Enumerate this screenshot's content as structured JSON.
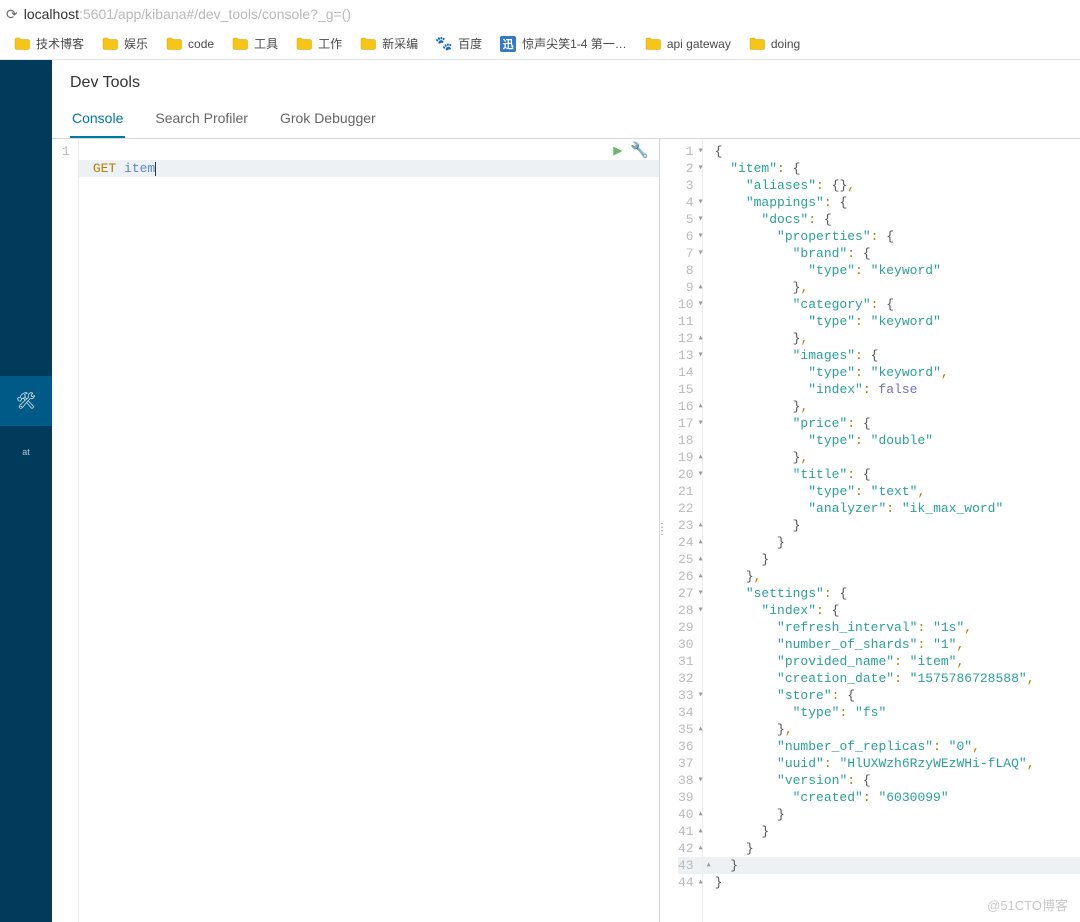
{
  "url": {
    "prefix_symbol": "⟳",
    "host": "localhost",
    "rest": ":5601/app/kibana#/dev_tools/console?_g=()"
  },
  "bookmarks": [
    {
      "label": "技术博客",
      "type": "folder"
    },
    {
      "label": "娱乐",
      "type": "folder"
    },
    {
      "label": "code",
      "type": "folder"
    },
    {
      "label": "工具",
      "type": "folder"
    },
    {
      "label": "工作",
      "type": "folder"
    },
    {
      "label": "新采编",
      "type": "folder"
    },
    {
      "label": "百度",
      "type": "site-baidu"
    },
    {
      "label": "惊声尖笑1-4 第一…",
      "type": "site-bili"
    },
    {
      "label": "api gateway",
      "type": "folder"
    },
    {
      "label": "doing",
      "type": "folder"
    }
  ],
  "sidebar": {
    "active_index": 5,
    "items": [
      "",
      "",
      "",
      "",
      "",
      "",
      "at"
    ]
  },
  "page": {
    "title": "Dev Tools"
  },
  "tabs": [
    {
      "label": "Console",
      "active": true
    },
    {
      "label": "Search Profiler",
      "active": false
    },
    {
      "label": "Grok Debugger",
      "active": false
    }
  ],
  "request": {
    "line_no": "1",
    "method": "GET",
    "endpoint": "item"
  },
  "response_lines": [
    {
      "n": 1,
      "fold": "down",
      "txt": [
        [
          "brace",
          "{"
        ]
      ]
    },
    {
      "n": 2,
      "fold": "down",
      "txt": [
        [
          "pad",
          1
        ],
        [
          "key",
          "\"item\""
        ],
        [
          "punc",
          ": "
        ],
        [
          "brace",
          "{"
        ]
      ]
    },
    {
      "n": 3,
      "txt": [
        [
          "pad",
          2
        ],
        [
          "key",
          "\"aliases\""
        ],
        [
          "punc",
          ": "
        ],
        [
          "brace",
          "{}"
        ],
        [
          "punc",
          ","
        ]
      ]
    },
    {
      "n": 4,
      "fold": "down",
      "txt": [
        [
          "pad",
          2
        ],
        [
          "key",
          "\"mappings\""
        ],
        [
          "punc",
          ": "
        ],
        [
          "brace",
          "{"
        ]
      ]
    },
    {
      "n": 5,
      "fold": "down",
      "txt": [
        [
          "pad",
          3
        ],
        [
          "key",
          "\"docs\""
        ],
        [
          "punc",
          ": "
        ],
        [
          "brace",
          "{"
        ]
      ]
    },
    {
      "n": 6,
      "fold": "down",
      "txt": [
        [
          "pad",
          4
        ],
        [
          "key",
          "\"properties\""
        ],
        [
          "punc",
          ": "
        ],
        [
          "brace",
          "{"
        ]
      ]
    },
    {
      "n": 7,
      "fold": "down",
      "txt": [
        [
          "pad",
          5
        ],
        [
          "key",
          "\"brand\""
        ],
        [
          "punc",
          ": "
        ],
        [
          "brace",
          "{"
        ]
      ]
    },
    {
      "n": 8,
      "txt": [
        [
          "pad",
          6
        ],
        [
          "key",
          "\"type\""
        ],
        [
          "punc",
          ": "
        ],
        [
          "str",
          "\"keyword\""
        ]
      ]
    },
    {
      "n": 9,
      "fold": "up",
      "txt": [
        [
          "pad",
          5
        ],
        [
          "brace",
          "}"
        ],
        [
          "punc",
          ","
        ]
      ]
    },
    {
      "n": 10,
      "fold": "down",
      "txt": [
        [
          "pad",
          5
        ],
        [
          "key",
          "\"category\""
        ],
        [
          "punc",
          ": "
        ],
        [
          "brace",
          "{"
        ]
      ]
    },
    {
      "n": 11,
      "txt": [
        [
          "pad",
          6
        ],
        [
          "key",
          "\"type\""
        ],
        [
          "punc",
          ": "
        ],
        [
          "str",
          "\"keyword\""
        ]
      ]
    },
    {
      "n": 12,
      "fold": "up",
      "txt": [
        [
          "pad",
          5
        ],
        [
          "brace",
          "}"
        ],
        [
          "punc",
          ","
        ]
      ]
    },
    {
      "n": 13,
      "fold": "down",
      "txt": [
        [
          "pad",
          5
        ],
        [
          "key",
          "\"images\""
        ],
        [
          "punc",
          ": "
        ],
        [
          "brace",
          "{"
        ]
      ]
    },
    {
      "n": 14,
      "txt": [
        [
          "pad",
          6
        ],
        [
          "key",
          "\"type\""
        ],
        [
          "punc",
          ": "
        ],
        [
          "str",
          "\"keyword\""
        ],
        [
          "punc",
          ","
        ]
      ]
    },
    {
      "n": 15,
      "txt": [
        [
          "pad",
          6
        ],
        [
          "key",
          "\"index\""
        ],
        [
          "punc",
          ": "
        ],
        [
          "false",
          "false"
        ]
      ]
    },
    {
      "n": 16,
      "fold": "up",
      "txt": [
        [
          "pad",
          5
        ],
        [
          "brace",
          "}"
        ],
        [
          "punc",
          ","
        ]
      ]
    },
    {
      "n": 17,
      "fold": "down",
      "txt": [
        [
          "pad",
          5
        ],
        [
          "key",
          "\"price\""
        ],
        [
          "punc",
          ": "
        ],
        [
          "brace",
          "{"
        ]
      ]
    },
    {
      "n": 18,
      "txt": [
        [
          "pad",
          6
        ],
        [
          "key",
          "\"type\""
        ],
        [
          "punc",
          ": "
        ],
        [
          "str",
          "\"double\""
        ]
      ]
    },
    {
      "n": 19,
      "fold": "up",
      "txt": [
        [
          "pad",
          5
        ],
        [
          "brace",
          "}"
        ],
        [
          "punc",
          ","
        ]
      ]
    },
    {
      "n": 20,
      "fold": "down",
      "txt": [
        [
          "pad",
          5
        ],
        [
          "key",
          "\"title\""
        ],
        [
          "punc",
          ": "
        ],
        [
          "brace",
          "{"
        ]
      ]
    },
    {
      "n": 21,
      "txt": [
        [
          "pad",
          6
        ],
        [
          "key",
          "\"type\""
        ],
        [
          "punc",
          ": "
        ],
        [
          "str",
          "\"text\""
        ],
        [
          "punc",
          ","
        ]
      ]
    },
    {
      "n": 22,
      "txt": [
        [
          "pad",
          6
        ],
        [
          "key",
          "\"analyzer\""
        ],
        [
          "punc",
          ": "
        ],
        [
          "str",
          "\"ik_max_word\""
        ]
      ]
    },
    {
      "n": 23,
      "fold": "up",
      "txt": [
        [
          "pad",
          5
        ],
        [
          "brace",
          "}"
        ]
      ]
    },
    {
      "n": 24,
      "fold": "up",
      "txt": [
        [
          "pad",
          4
        ],
        [
          "brace",
          "}"
        ]
      ]
    },
    {
      "n": 25,
      "fold": "up",
      "txt": [
        [
          "pad",
          3
        ],
        [
          "brace",
          "}"
        ]
      ]
    },
    {
      "n": 26,
      "fold": "up",
      "txt": [
        [
          "pad",
          2
        ],
        [
          "brace",
          "}"
        ],
        [
          "punc",
          ","
        ]
      ]
    },
    {
      "n": 27,
      "fold": "down",
      "txt": [
        [
          "pad",
          2
        ],
        [
          "key",
          "\"settings\""
        ],
        [
          "punc",
          ": "
        ],
        [
          "brace",
          "{"
        ]
      ]
    },
    {
      "n": 28,
      "fold": "down",
      "txt": [
        [
          "pad",
          3
        ],
        [
          "key",
          "\"index\""
        ],
        [
          "punc",
          ": "
        ],
        [
          "brace",
          "{"
        ]
      ]
    },
    {
      "n": 29,
      "txt": [
        [
          "pad",
          4
        ],
        [
          "key",
          "\"refresh_interval\""
        ],
        [
          "punc",
          ": "
        ],
        [
          "str",
          "\"1s\""
        ],
        [
          "punc",
          ","
        ]
      ]
    },
    {
      "n": 30,
      "txt": [
        [
          "pad",
          4
        ],
        [
          "key",
          "\"number_of_shards\""
        ],
        [
          "punc",
          ": "
        ],
        [
          "str",
          "\"1\""
        ],
        [
          "punc",
          ","
        ]
      ]
    },
    {
      "n": 31,
      "txt": [
        [
          "pad",
          4
        ],
        [
          "key",
          "\"provided_name\""
        ],
        [
          "punc",
          ": "
        ],
        [
          "str",
          "\"item\""
        ],
        [
          "punc",
          ","
        ]
      ]
    },
    {
      "n": 32,
      "txt": [
        [
          "pad",
          4
        ],
        [
          "key",
          "\"creation_date\""
        ],
        [
          "punc",
          ": "
        ],
        [
          "str",
          "\"1575786728588\""
        ],
        [
          "punc",
          ","
        ]
      ]
    },
    {
      "n": 33,
      "fold": "down",
      "txt": [
        [
          "pad",
          4
        ],
        [
          "key",
          "\"store\""
        ],
        [
          "punc",
          ": "
        ],
        [
          "brace",
          "{"
        ]
      ]
    },
    {
      "n": 34,
      "txt": [
        [
          "pad",
          5
        ],
        [
          "key",
          "\"type\""
        ],
        [
          "punc",
          ": "
        ],
        [
          "str",
          "\"fs\""
        ]
      ]
    },
    {
      "n": 35,
      "fold": "up",
      "txt": [
        [
          "pad",
          4
        ],
        [
          "brace",
          "}"
        ],
        [
          "punc",
          ","
        ]
      ]
    },
    {
      "n": 36,
      "txt": [
        [
          "pad",
          4
        ],
        [
          "key",
          "\"number_of_replicas\""
        ],
        [
          "punc",
          ": "
        ],
        [
          "str",
          "\"0\""
        ],
        [
          "punc",
          ","
        ]
      ]
    },
    {
      "n": 37,
      "txt": [
        [
          "pad",
          4
        ],
        [
          "key",
          "\"uuid\""
        ],
        [
          "punc",
          ": "
        ],
        [
          "str",
          "\"HlUXWzh6RzyWEzWHi-fLAQ\""
        ],
        [
          "punc",
          ","
        ]
      ]
    },
    {
      "n": 38,
      "fold": "down",
      "txt": [
        [
          "pad",
          4
        ],
        [
          "key",
          "\"version\""
        ],
        [
          "punc",
          ": "
        ],
        [
          "brace",
          "{"
        ]
      ]
    },
    {
      "n": 39,
      "txt": [
        [
          "pad",
          5
        ],
        [
          "key",
          "\"created\""
        ],
        [
          "punc",
          ": "
        ],
        [
          "str",
          "\"6030099\""
        ]
      ]
    },
    {
      "n": 40,
      "fold": "up",
      "txt": [
        [
          "pad",
          4
        ],
        [
          "brace",
          "}"
        ]
      ]
    },
    {
      "n": 41,
      "fold": "up",
      "txt": [
        [
          "pad",
          3
        ],
        [
          "brace",
          "}"
        ]
      ]
    },
    {
      "n": 42,
      "fold": "up",
      "txt": [
        [
          "pad",
          2
        ],
        [
          "brace",
          "}"
        ]
      ]
    },
    {
      "n": 43,
      "fold": "up",
      "hl": true,
      "txt": [
        [
          "pad",
          1
        ],
        [
          "brace",
          "}"
        ]
      ]
    },
    {
      "n": 44,
      "fold": "up",
      "txt": [
        [
          "brace",
          "}"
        ]
      ]
    }
  ],
  "watermark": "@51CTO博客"
}
